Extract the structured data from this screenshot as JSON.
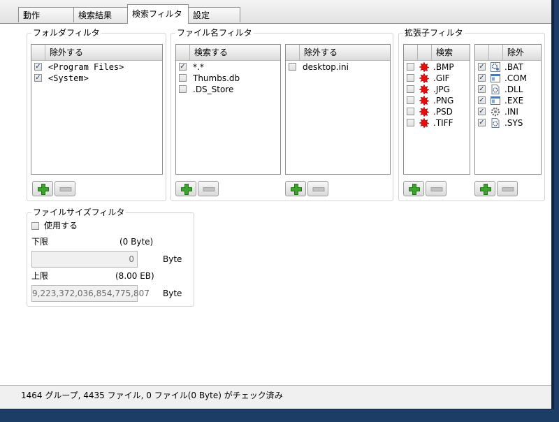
{
  "tabs": [
    {
      "label": "動作"
    },
    {
      "label": "検索結果"
    },
    {
      "label": "検索フィルタ"
    },
    {
      "label": "設定"
    }
  ],
  "folder_filter": {
    "title": "フォルダフィルタ",
    "header": "除外する",
    "items": [
      {
        "label": "<Program Files>",
        "checked": true
      },
      {
        "label": "<System>",
        "checked": true
      }
    ]
  },
  "filename_filter": {
    "title": "ファイル名フィルタ",
    "search": {
      "header": "検索する",
      "items": [
        {
          "label": "*.*",
          "checked": true
        },
        {
          "label": "Thumbs.db",
          "checked": false
        },
        {
          "label": ".DS_Store",
          "checked": false
        }
      ]
    },
    "exclude": {
      "header": "除外する",
      "items": [
        {
          "label": "desktop.ini",
          "checked": false
        }
      ]
    }
  },
  "extension_filter": {
    "title": "拡張子フィルタ",
    "search": {
      "header": "検索",
      "items": [
        {
          "label": ".BMP",
          "checked": false,
          "icon": "image-paint-icon"
        },
        {
          "label": ".GIF",
          "checked": false,
          "icon": "image-paint-icon"
        },
        {
          "label": ".JPG",
          "checked": false,
          "icon": "image-paint-icon"
        },
        {
          "label": ".PNG",
          "checked": false,
          "icon": "image-paint-icon"
        },
        {
          "label": ".PSD",
          "checked": false,
          "icon": "image-paint-icon"
        },
        {
          "label": ".TIFF",
          "checked": false,
          "icon": "image-paint-icon"
        }
      ]
    },
    "exclude": {
      "header": "除外",
      "items": [
        {
          "label": ".BAT",
          "checked": true,
          "icon": "batch-gear-icon"
        },
        {
          "label": ".COM",
          "checked": true,
          "icon": "program-window-icon"
        },
        {
          "label": ".DLL",
          "checked": true,
          "icon": "dll-gear-icon"
        },
        {
          "label": ".EXE",
          "checked": true,
          "icon": "program-window-icon"
        },
        {
          "label": ".INI",
          "checked": true,
          "icon": "settings-gear-icon"
        },
        {
          "label": ".SYS",
          "checked": true,
          "icon": "dll-gear-icon"
        }
      ]
    }
  },
  "size_filter": {
    "title": "ファイルサイズフィルタ",
    "use_label": "使用する",
    "use_checked": false,
    "lower_label": "下限",
    "lower_hint": "(0 Byte)",
    "lower_value": "0",
    "upper_label": "上限",
    "upper_hint": "(8.00 EB)",
    "upper_value": "9,223,372,036,854,775,807",
    "unit": "Byte"
  },
  "status": "1464 グループ, 4435 ファイル, 0 ファイル(0 Byte) がチェック済み",
  "colors": {
    "plus_green": "#3aa52a",
    "minus_gray": "#b4b4b4",
    "paint_red": "#e01010"
  }
}
